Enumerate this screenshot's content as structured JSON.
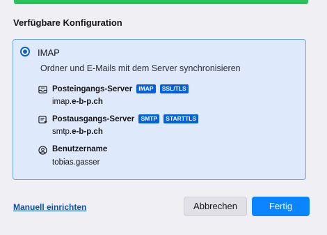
{
  "section_title": "Verfügbare Konfiguration",
  "config": {
    "protocol": "IMAP",
    "description": "Ordner und E-Mails mit dem Server synchronisieren",
    "incoming": {
      "label": "Posteingangs-Server",
      "badges": [
        "IMAP",
        "SSL/TLS"
      ],
      "value_prefix": "imap.",
      "value_domain": "e-b-p.ch",
      "icon": "inbox-icon"
    },
    "outgoing": {
      "label": "Postausgangs-Server",
      "badges": [
        "SMTP",
        "STARTTLS"
      ],
      "value_prefix": "smtp.",
      "value_domain": "e-b-p.ch",
      "icon": "outbox-icon"
    },
    "username": {
      "label": "Benutzername",
      "value": "tobias.gasser",
      "icon": "user-icon"
    }
  },
  "footer": {
    "manual_link": "Manuell einrichten",
    "cancel_label": "Abbrechen",
    "done_label": "Fertig"
  },
  "colors": {
    "accent": "#0060df",
    "primary_button": "#0a84ff",
    "card_background": "#deeafc",
    "card_border": "#6aa6ea",
    "progress_bar": "#2ac35a"
  }
}
